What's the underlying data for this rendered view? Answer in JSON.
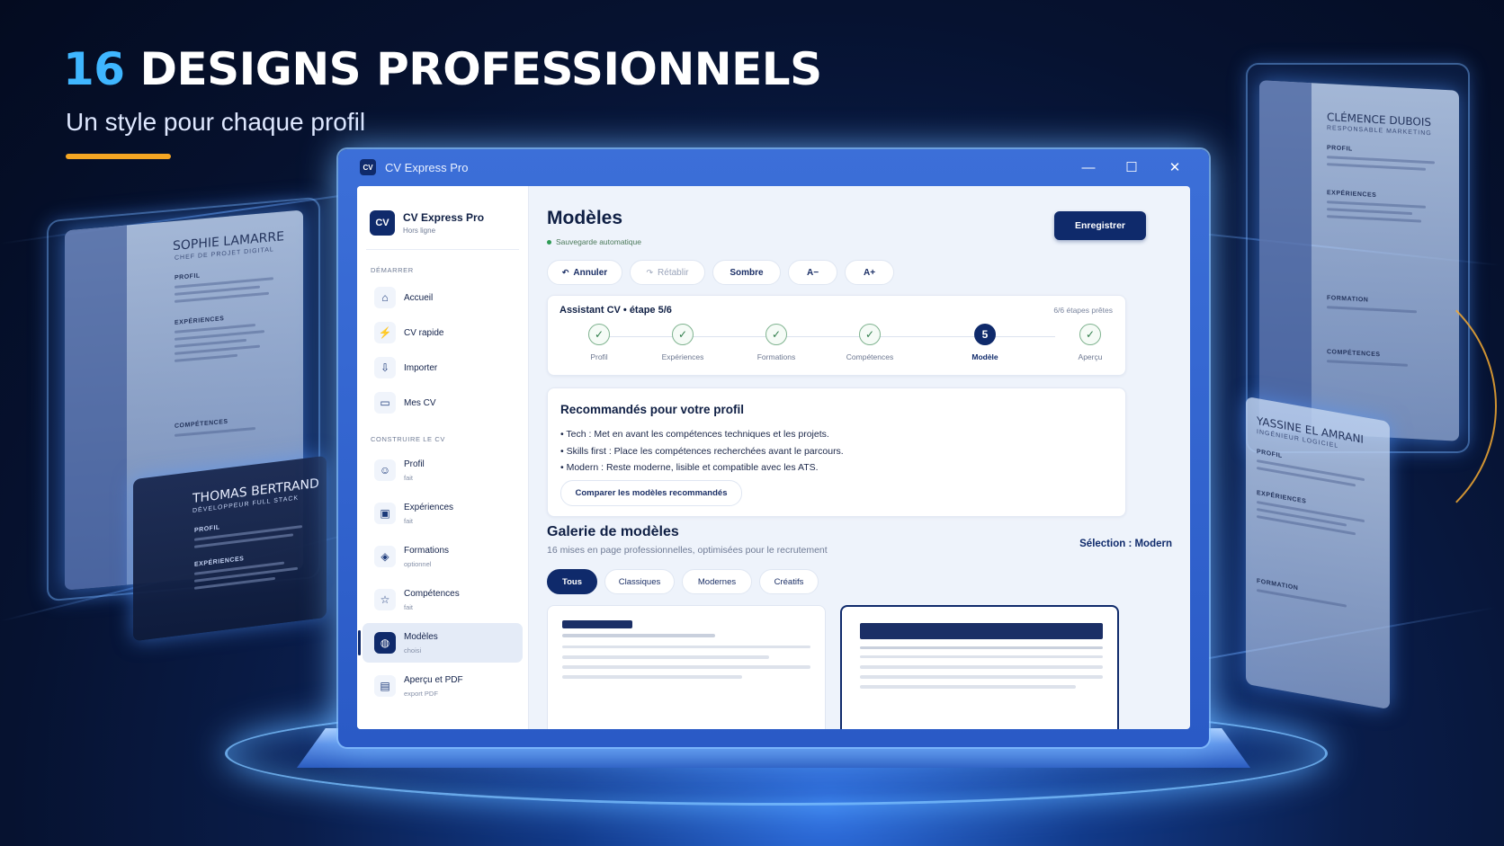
{
  "hero": {
    "title_number": "16",
    "title_rest": "DESIGNS PROFESSIONNELS",
    "subtitle": "Un style pour chaque profil"
  },
  "background_cards": [
    {
      "name": "SOPHIE LAMARRE",
      "role": "CHEF DE PROJET DIGITAL",
      "sections": [
        "PROFIL",
        "EXPÉRIENCES",
        "COMPÉTENCES"
      ]
    },
    {
      "name": "THOMAS BERTRAND",
      "role": "DÉVELOPPEUR FULL STACK",
      "sections": [
        "PROFIL",
        "EXPÉRIENCES"
      ]
    },
    {
      "name": "CLÉMENCE DUBOIS",
      "role": "RESPONSABLE MARKETING",
      "sections": [
        "PROFIL",
        "EXPÉRIENCES",
        "FORMATION",
        "COMPÉTENCES"
      ]
    },
    {
      "name": "YASSINE EL AMRANI",
      "role": "INGÉNIEUR LOGICIEL",
      "sections": [
        "PROFIL",
        "EXPÉRIENCES",
        "FORMATION"
      ]
    }
  ],
  "window": {
    "logo": "CV",
    "title": "CV Express Pro",
    "controls": {
      "minimize": "—",
      "maximize": "☐",
      "close": "✕"
    }
  },
  "sidebar": {
    "brand_logo": "CV",
    "brand_name": "CV Express Pro",
    "brand_status": "Hors ligne",
    "section_start": "DÉMARRER",
    "start_items": [
      {
        "label": "Accueil",
        "icon": "home-icon"
      },
      {
        "label": "CV rapide",
        "icon": "bolt-icon"
      },
      {
        "label": "Importer",
        "icon": "import-icon"
      },
      {
        "label": "Mes CV",
        "icon": "folder-icon"
      }
    ],
    "section_build": "CONSTRUIRE LE CV",
    "build_items": [
      {
        "label": "Profil",
        "sub": "fait",
        "icon": "user-icon"
      },
      {
        "label": "Expériences",
        "sub": "fait",
        "icon": "briefcase-icon"
      },
      {
        "label": "Formations",
        "sub": "optionnel",
        "icon": "graduation-cap-icon"
      },
      {
        "label": "Compétences",
        "sub": "fait",
        "icon": "star-icon"
      },
      {
        "label": "Modèles",
        "sub": "choisi",
        "icon": "palette-icon"
      },
      {
        "label": "Aperçu et PDF",
        "sub": "export PDF",
        "icon": "preview-icon"
      }
    ]
  },
  "main": {
    "title": "Modèles",
    "autosave": "Sauvegarde automatique",
    "save_button": "Enregistrer",
    "toolbar": {
      "undo": "Annuler",
      "redo": "Rétablir",
      "theme": "Sombre",
      "font_smaller": "A−",
      "font_larger": "A+"
    },
    "wizard": {
      "title": "Assistant CV • étape 5/6",
      "count": "6/6 étapes prêtes",
      "steps": [
        {
          "label": "Profil",
          "state": "done"
        },
        {
          "label": "Expériences",
          "state": "done"
        },
        {
          "label": "Formations",
          "state": "done"
        },
        {
          "label": "Compétences",
          "state": "done"
        },
        {
          "label": "Modèle",
          "state": "current",
          "number": "5"
        },
        {
          "label": "Aperçu",
          "state": "done"
        }
      ]
    },
    "recommended": {
      "title": "Recommandés pour votre profil",
      "items": [
        "• Tech : Met en avant les compétences techniques et les projets.",
        "• Skills first : Place les compétences recherchées avant le parcours.",
        "• Modern : Reste moderne, lisible et compatible avec les ATS."
      ],
      "compare_button": "Comparer les modèles recommandés"
    },
    "gallery": {
      "title": "Galerie de modèles",
      "subtitle": "16 mises en page professionnelles, optimisées pour le recrutement",
      "selection": "Sélection : Modern",
      "filters": [
        "Tous",
        "Classiques",
        "Modernes",
        "Créatifs"
      ],
      "active_filter": "Tous"
    }
  },
  "colors": {
    "accent_navy": "#0f2a6b",
    "highlight_blue": "#3fb6ff",
    "underline_gold": "#f5a623",
    "success_green": "#2e9b55"
  }
}
